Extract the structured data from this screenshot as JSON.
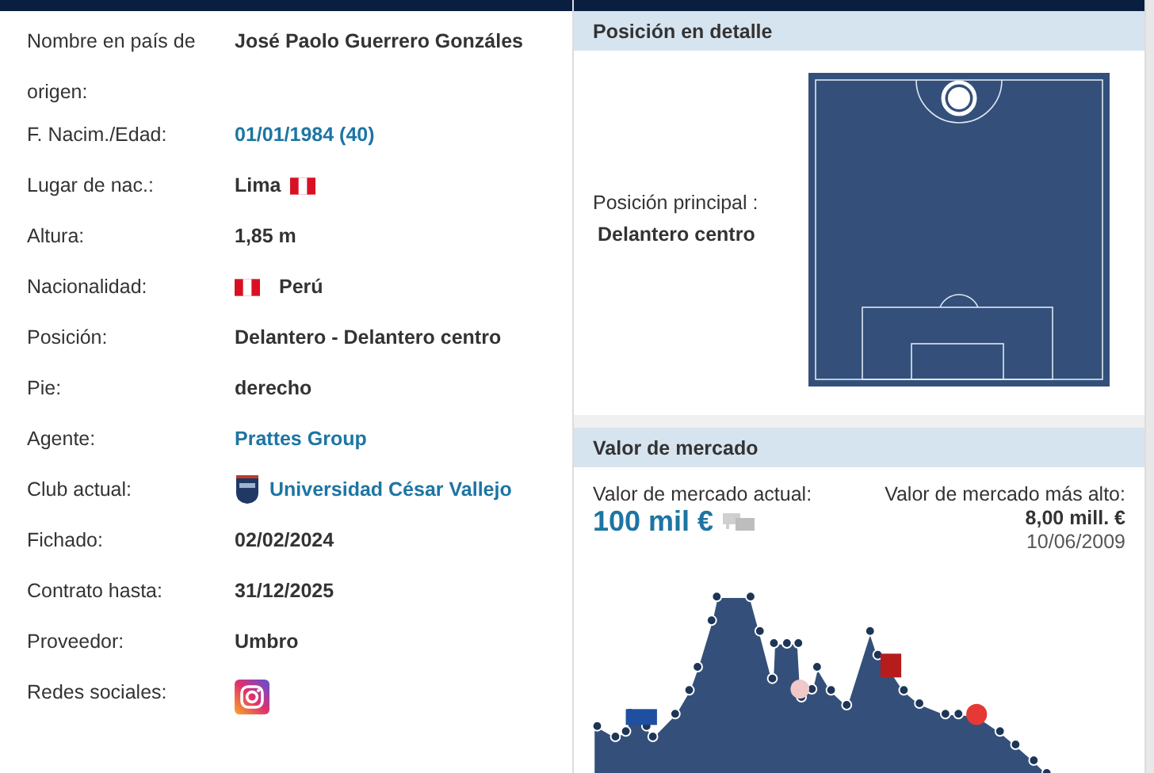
{
  "player_data": {
    "rows": [
      {
        "label": "Nombre en país de origen:",
        "value": "José Paolo Guerrero Gonzáles",
        "kind": "text"
      },
      {
        "label": "F. Nacim./Edad:",
        "value": "01/01/1984 (40)",
        "kind": "link"
      },
      {
        "label": "Lugar de nac.:",
        "value": "Lima",
        "kind": "place"
      },
      {
        "label": "Altura:",
        "value": "1,85 m",
        "kind": "text"
      },
      {
        "label": "Nacionalidad:",
        "value": "Perú",
        "kind": "country"
      },
      {
        "label": "Posición:",
        "value": "Delantero - Delantero centro",
        "kind": "text"
      },
      {
        "label": "Pie:",
        "value": "derecho",
        "kind": "text"
      },
      {
        "label": "Agente:",
        "value": "Prattes Group",
        "kind": "link"
      },
      {
        "label": "Club actual:",
        "value": "Universidad César Vallejo",
        "kind": "club"
      },
      {
        "label": "Fichado:",
        "value": "02/02/2024",
        "kind": "text"
      },
      {
        "label": "Contrato hasta:",
        "value": "31/12/2025",
        "kind": "text"
      },
      {
        "label": "Proveedor:",
        "value": "Umbro",
        "kind": "text"
      },
      {
        "label": "Redes sociales:",
        "kind": "social"
      }
    ]
  },
  "position_detail": {
    "title": "Posición en detalle",
    "main_label": "Posición principal :",
    "main_value": "Delantero centro"
  },
  "market_value": {
    "title": "Valor de mercado",
    "current_label": "Valor de mercado actual:",
    "current_value": "100 mil €",
    "highest_label": "Valor de mercado más alto:",
    "highest_value": "8,00 mill. €",
    "highest_date": "10/06/2009"
  }
}
